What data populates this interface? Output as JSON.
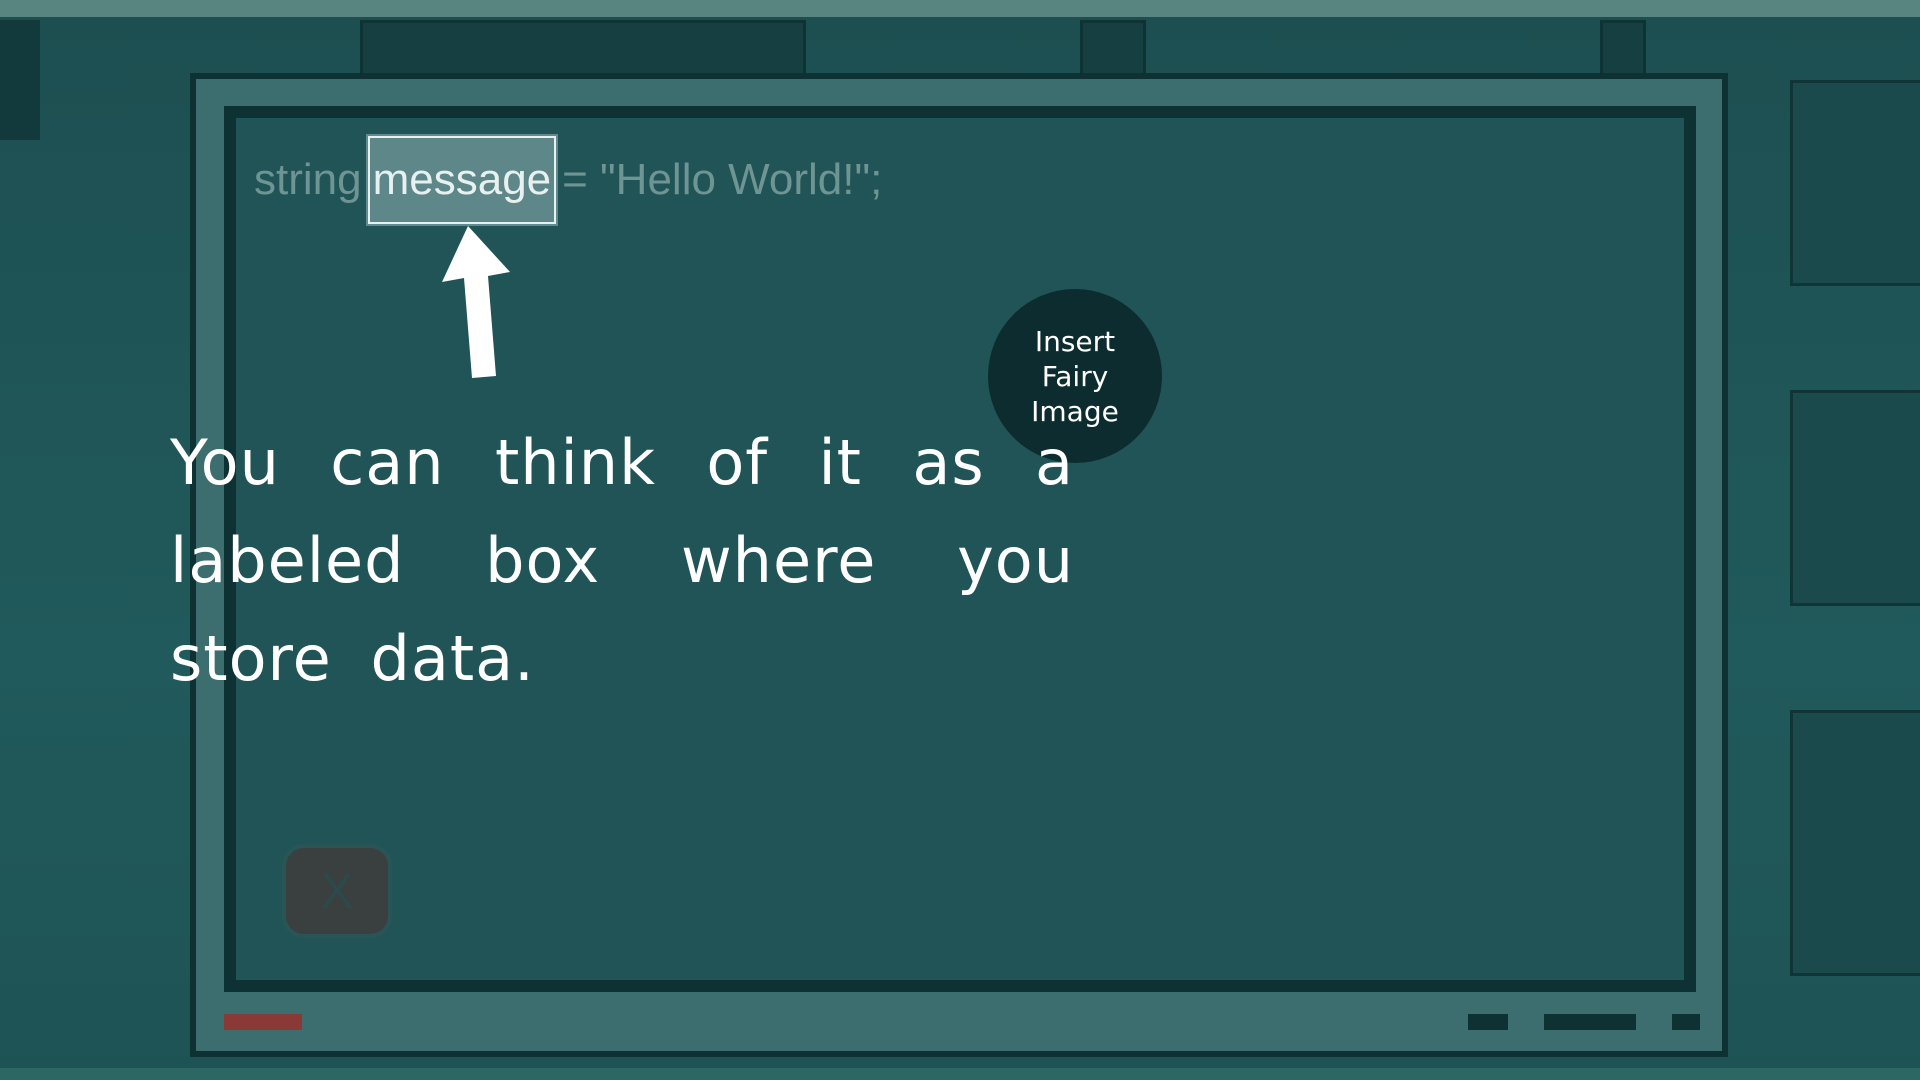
{
  "scene": {
    "code_prefix": "string",
    "code_variable": "message",
    "code_suffix": "= \"Hello World!\";",
    "caption": "You can think of it as a labeled box where you store data.",
    "fairy_placeholder": "Insert Fairy Image",
    "close_label": "X"
  },
  "colors": {
    "background": "#1f5557",
    "board_frame": "#0e3133",
    "highlight": "#5d8789",
    "fairy_circle": "#0c2c2f"
  },
  "icons": [
    "up-arrow-icon",
    "close-icon"
  ]
}
